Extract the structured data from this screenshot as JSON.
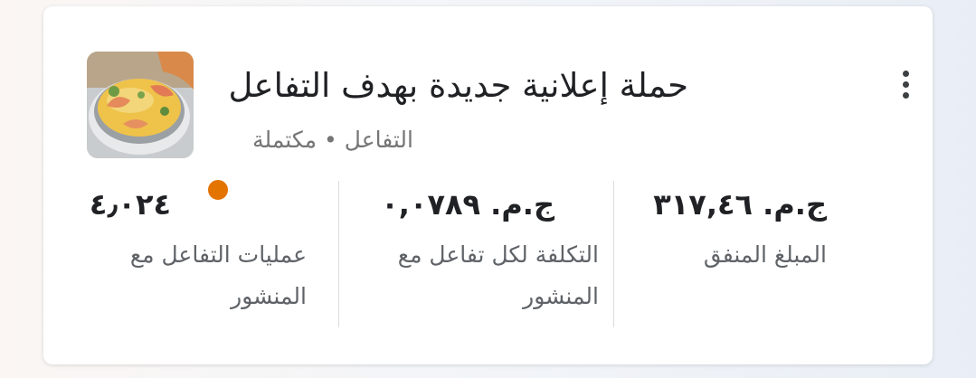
{
  "campaign": {
    "title": "حملة إعلانية جديدة بهدف التفاعل",
    "objective": "التفاعل",
    "status": "مكتملة",
    "separator": "•",
    "status_color": "#e37400",
    "thumbnail": "food-dish-thumbnail",
    "menu_icon": "more-vert-icon"
  },
  "metrics": [
    {
      "value": "ج.م. ٣١٧,٤٦",
      "label": "المبلغ المنفق"
    },
    {
      "value": "ج.م. ٠,٠٧٨٩",
      "label": "التكلفة لكل تفاعل مع المنشور"
    },
    {
      "value": "٤٫٠٢٤",
      "label": "عمليات التفاعل مع المنشور"
    }
  ]
}
